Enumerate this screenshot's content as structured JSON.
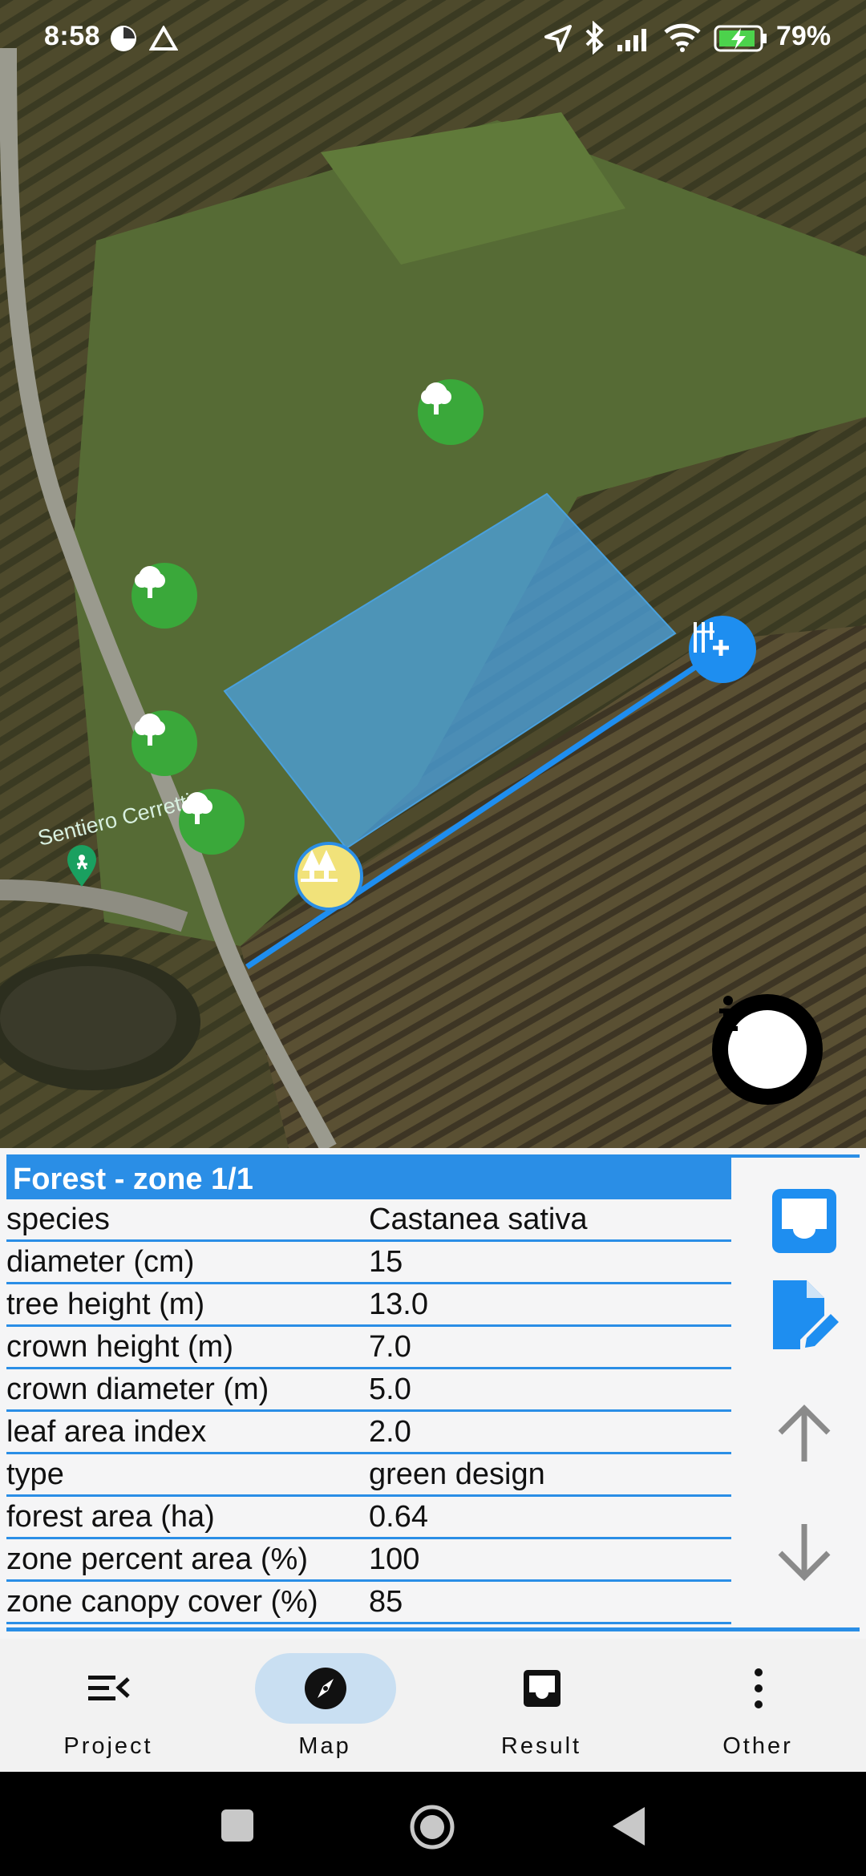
{
  "status_bar": {
    "time": "8:58",
    "battery": "79%",
    "icons": [
      "app-status-icon",
      "drive-icon",
      "location-arrow-icon",
      "bluetooth-icon",
      "signal-icon",
      "wifi-icon",
      "battery-charging-icon"
    ]
  },
  "map": {
    "place_label": "Sentiero Cerretti",
    "zone_color": "#4aa0dc",
    "tree_markers": [
      "tree-marker",
      "tree-marker",
      "tree-marker",
      "tree-marker"
    ],
    "colors": {
      "tree_marker": "#3aa83a",
      "line": "#1e8ef0"
    }
  },
  "panel": {
    "title": "Forest - zone 1/1",
    "rows": [
      {
        "key": "species",
        "value": "Castanea sativa"
      },
      {
        "key": "diameter (cm)",
        "value": "15"
      },
      {
        "key": "tree height (m)",
        "value": "13.0"
      },
      {
        "key": "crown height (m)",
        "value": "7.0"
      },
      {
        "key": "crown diameter (m)",
        "value": "5.0"
      },
      {
        "key": "leaf area index",
        "value": "2.0"
      },
      {
        "key": "type",
        "value": "green design"
      },
      {
        "key": "forest area (ha)",
        "value": "0.64"
      },
      {
        "key": "zone percent area (%)",
        "value": "100"
      },
      {
        "key": "zone canopy cover (%)",
        "value": "85"
      }
    ],
    "accent": "#2a8ee6"
  },
  "bottom_nav": {
    "items": [
      {
        "label": "Project",
        "icon": "menu-open-icon"
      },
      {
        "label": "Map",
        "icon": "compass-icon",
        "active": true
      },
      {
        "label": "Result",
        "icon": "inbox-icon"
      },
      {
        "label": "Other",
        "icon": "more-vert-icon"
      }
    ]
  }
}
